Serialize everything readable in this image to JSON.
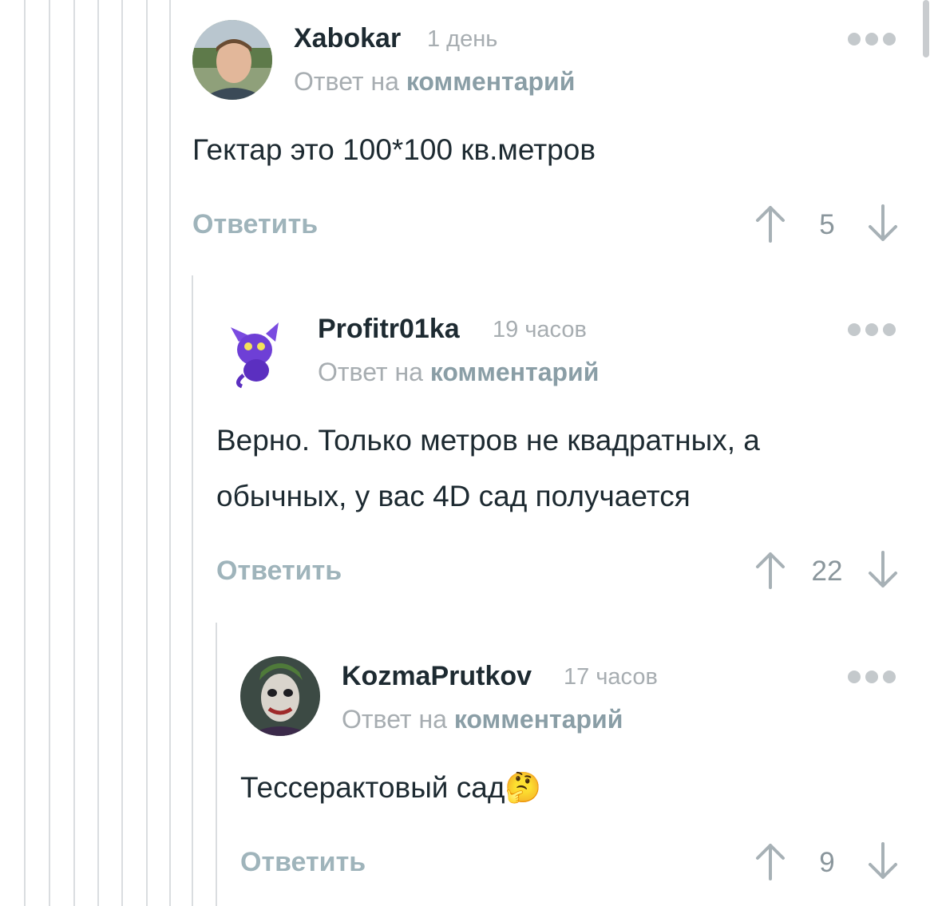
{
  "comments": [
    {
      "author": "Xabokar",
      "time": "1 день",
      "reply_prefix": "Ответ на",
      "reply_link": "комментарий",
      "text": "Гектар это 100*100 кв.метров",
      "reply_label": "Ответить",
      "score": "5"
    },
    {
      "author": "Profitr01ka",
      "time": "19 часов",
      "reply_prefix": "Ответ на",
      "reply_link": "комментарий",
      "text_line1": "Верно. Только метров не квадратных, а",
      "text_line2": "обычных, у вас 4D сад получается",
      "reply_label": "Ответить",
      "score": "22"
    },
    {
      "author": "KozmaPrutkov",
      "time": "17 часов",
      "reply_prefix": "Ответ на",
      "reply_link": "комментарий",
      "text": "Тессерактовый сад",
      "emoji": "🤔",
      "reply_label": "Ответить",
      "score": "9"
    }
  ],
  "icons": {
    "upvote": "arrow-up-icon",
    "downvote": "arrow-down-icon",
    "more": "more-dots-icon"
  },
  "colors": {
    "author": "#1d2a31",
    "muted": "#a7adb1",
    "link": "#8a9ea6",
    "thread_line": "#dadde0"
  }
}
